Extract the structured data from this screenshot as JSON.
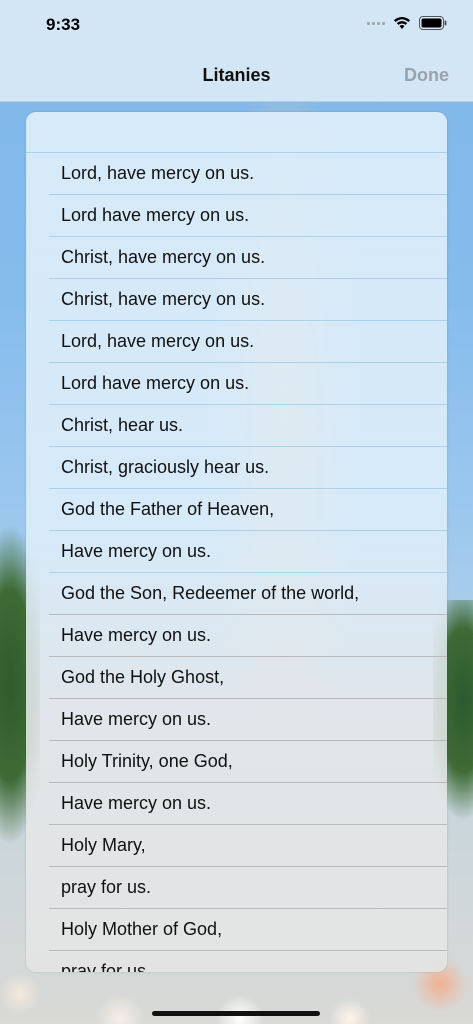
{
  "status_bar": {
    "time": "9:33"
  },
  "nav": {
    "title": "Litanies",
    "done_label": "Done"
  },
  "rows": [
    "Lord, have mercy on us.",
    "Lord have mercy on us.",
    "Christ, have mercy on us.",
    "Christ, have mercy on us.",
    "Lord, have mercy on us.",
    "Lord have mercy on us.",
    "Christ, hear us.",
    "Christ, graciously hear us.",
    "God the Father of Heaven,",
    "Have mercy on us.",
    "God the Son, Redeemer of the world,",
    "Have mercy on us.",
    "God the Holy Ghost,",
    "Have mercy on us.",
    "Holy Trinity, one God,",
    "Have mercy on us.",
    "Holy Mary,",
    "pray for us.",
    "Holy Mother of God,",
    "pray for us."
  ]
}
